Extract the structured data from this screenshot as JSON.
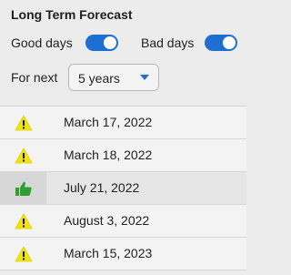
{
  "panel": {
    "title": "Long Term Forecast",
    "good_days_label": "Good days",
    "good_days_on": true,
    "bad_days_label": "Bad days",
    "bad_days_on": true,
    "for_next_label": "For next",
    "for_next_value": "5 years"
  },
  "colors": {
    "accent": "#1f6fd3",
    "warning": "#f2e500",
    "good": "#2e9e2e"
  },
  "events": [
    {
      "icon": "warning-icon",
      "date": "March 17, 2022"
    },
    {
      "icon": "warning-icon",
      "date": "March 18, 2022"
    },
    {
      "icon": "thumbs-up-icon",
      "date": "July 21, 2022"
    },
    {
      "icon": "warning-icon",
      "date": "August 3, 2022"
    },
    {
      "icon": "warning-icon",
      "date": "March 15, 2023"
    }
  ]
}
